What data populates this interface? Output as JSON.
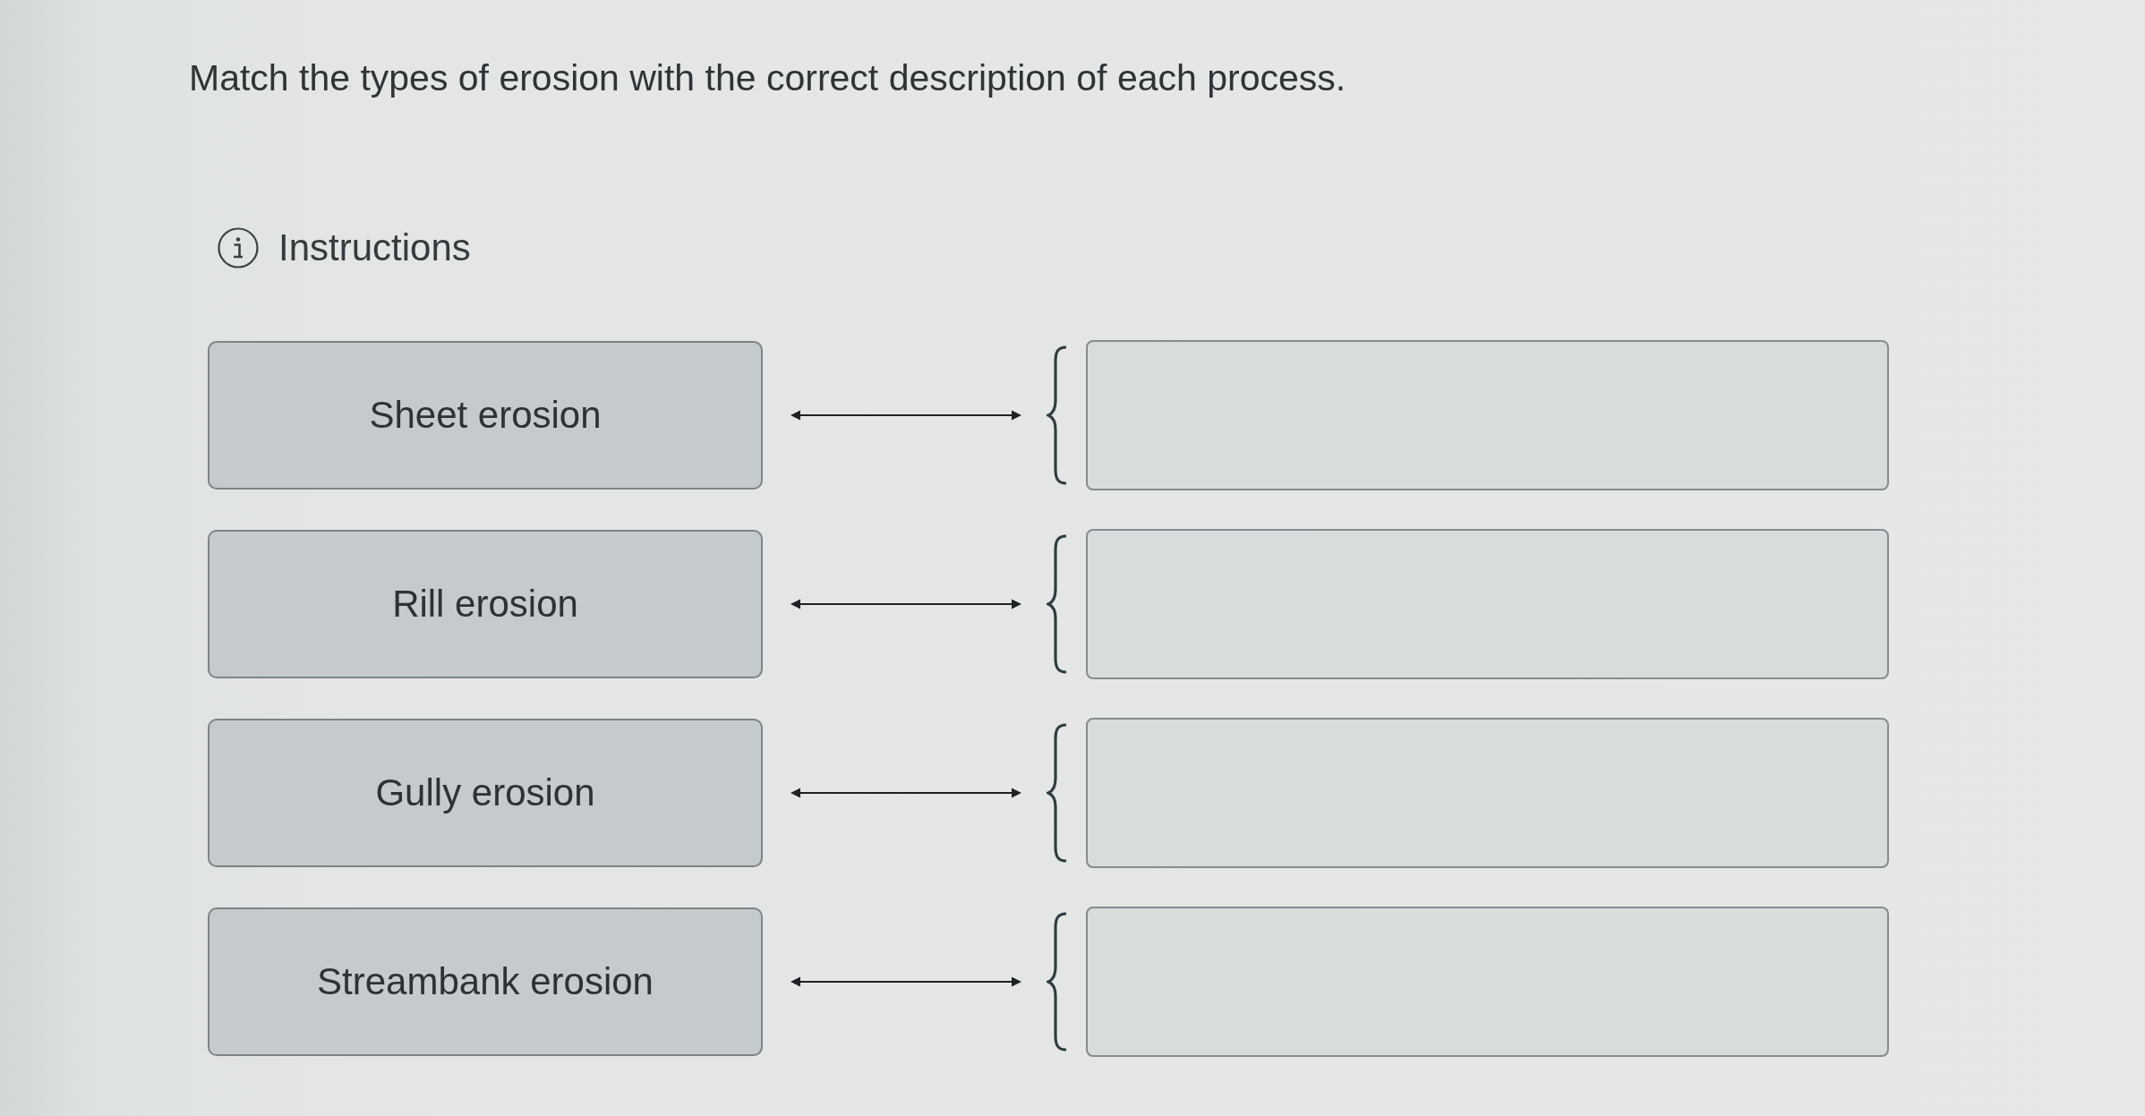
{
  "prompt": "Match the types of erosion with the correct description of each process.",
  "instructions": {
    "label": "Instructions"
  },
  "pairs": [
    {
      "term": "Sheet erosion"
    },
    {
      "term": "Rill erosion"
    },
    {
      "term": "Gully erosion"
    },
    {
      "term": "Streambank erosion"
    }
  ]
}
